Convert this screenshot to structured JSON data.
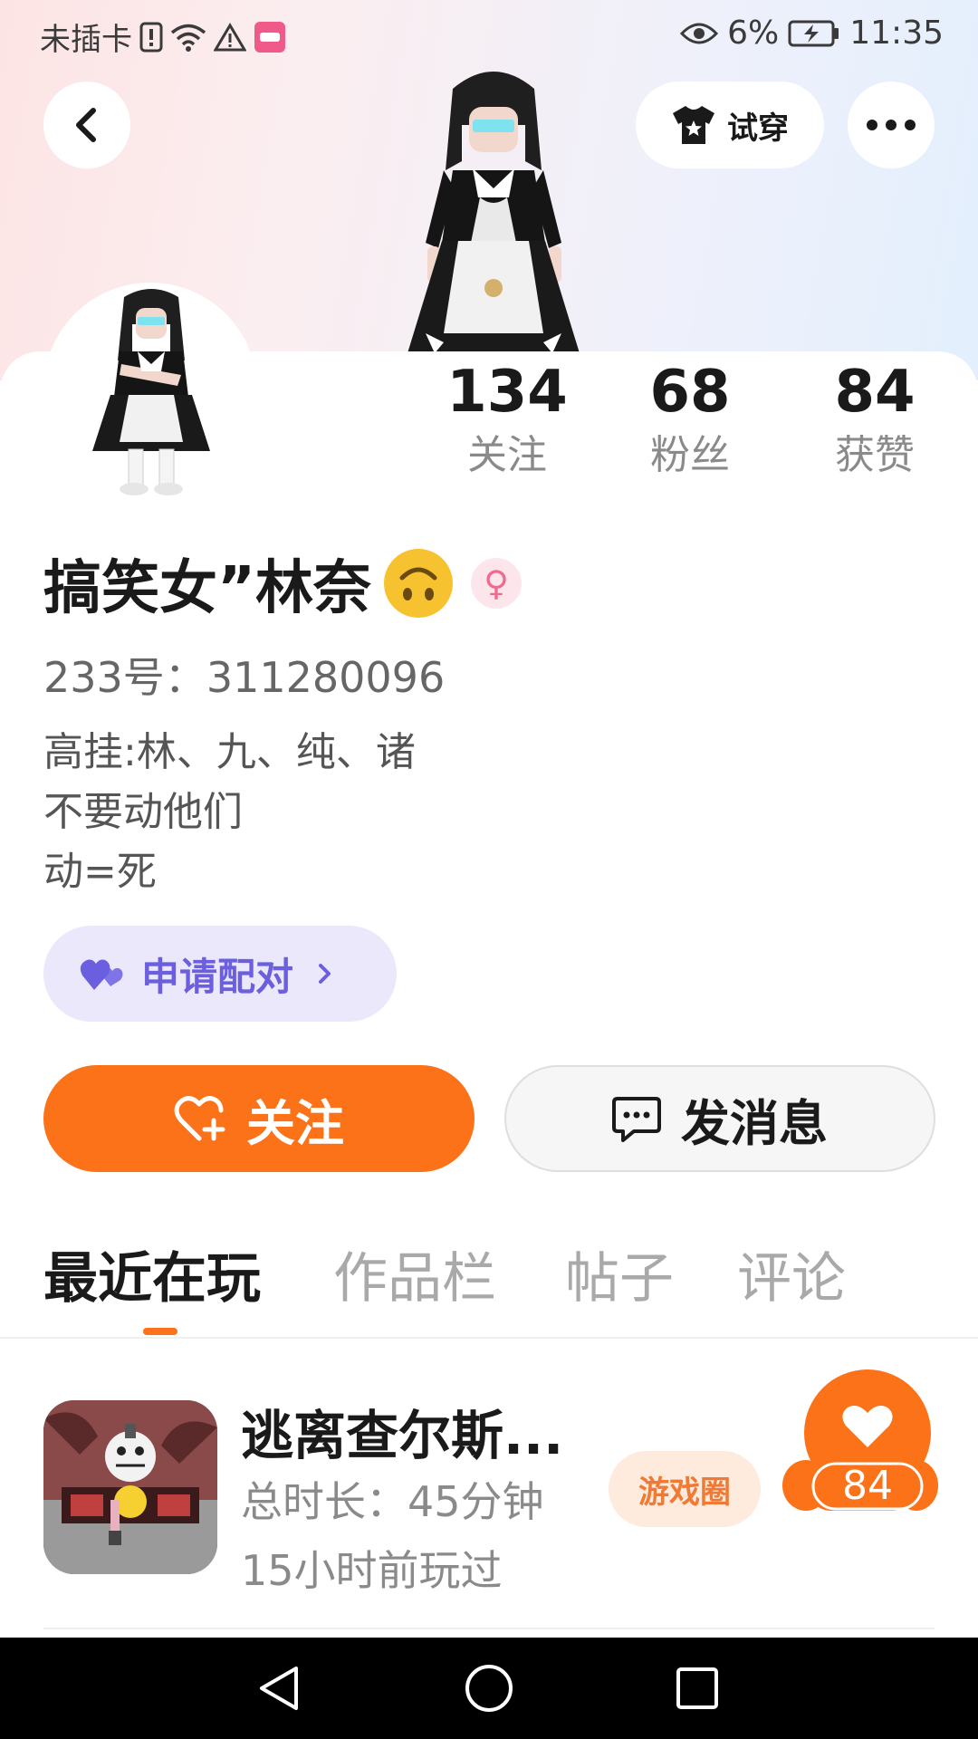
{
  "status_bar": {
    "carrier": "未插卡",
    "battery_percent": "6%",
    "time": "11:35"
  },
  "header": {
    "try_on_label": "试穿"
  },
  "stats": [
    {
      "value": "134",
      "label": "关注"
    },
    {
      "value": "68",
      "label": "粉丝"
    },
    {
      "value": "84",
      "label": "获赞"
    }
  ],
  "profile": {
    "name": "搞笑女”林奈",
    "id_label": "233号：",
    "id_value": "311280096",
    "bio_lines": [
      "高挂:林、九、纯、诸",
      "不要动他们",
      "动=死"
    ],
    "gender_symbol": "♀"
  },
  "pair_button": {
    "label": "申请配对"
  },
  "actions": {
    "follow_label": "关注",
    "message_label": "发消息"
  },
  "tabs": [
    {
      "label": "最近在玩",
      "active": true
    },
    {
      "label": "作品栏",
      "active": false
    },
    {
      "label": "帖子",
      "active": false
    },
    {
      "label": "评论",
      "active": false
    }
  ],
  "recent_games": [
    {
      "title": "逃离查尔斯...",
      "total_time": "总时长：45分钟",
      "last_played": "15小时前玩过",
      "circle_label": "游戏圈",
      "likes": "84"
    }
  ],
  "colors": {
    "accent_orange": "#fc7219",
    "pair_purple": "#6b5fe0",
    "pair_bg": "#ebe8fb"
  }
}
